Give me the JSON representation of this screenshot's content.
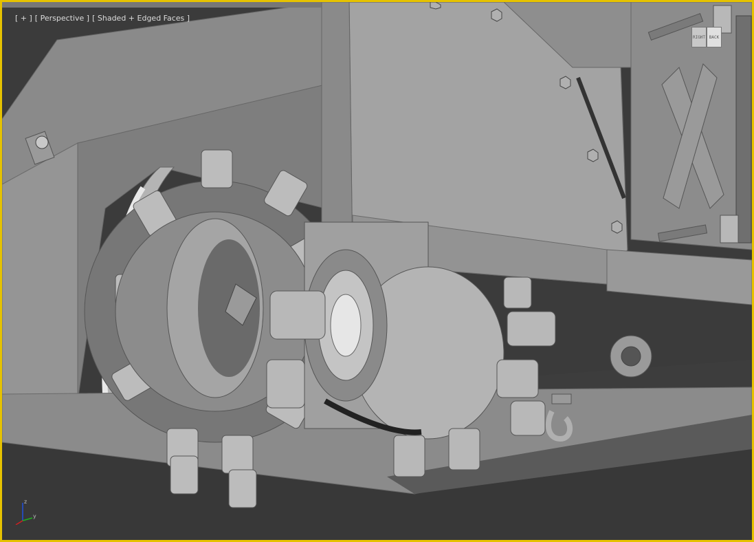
{
  "viewport": {
    "label_plus": "[ + ]",
    "label_view": "[ Perspective ]",
    "label_shading": "[ Shaded + Edged Faces ]",
    "active_border_color": "#e6c200"
  },
  "viewcube": {
    "left_face": "RIGHT",
    "right_face": "BACK"
  },
  "axis_tripod": {
    "z_label": "z",
    "y_label": "y",
    "colors": {
      "x": "#d02020",
      "y": "#20b020",
      "z": "#2050e0"
    }
  }
}
